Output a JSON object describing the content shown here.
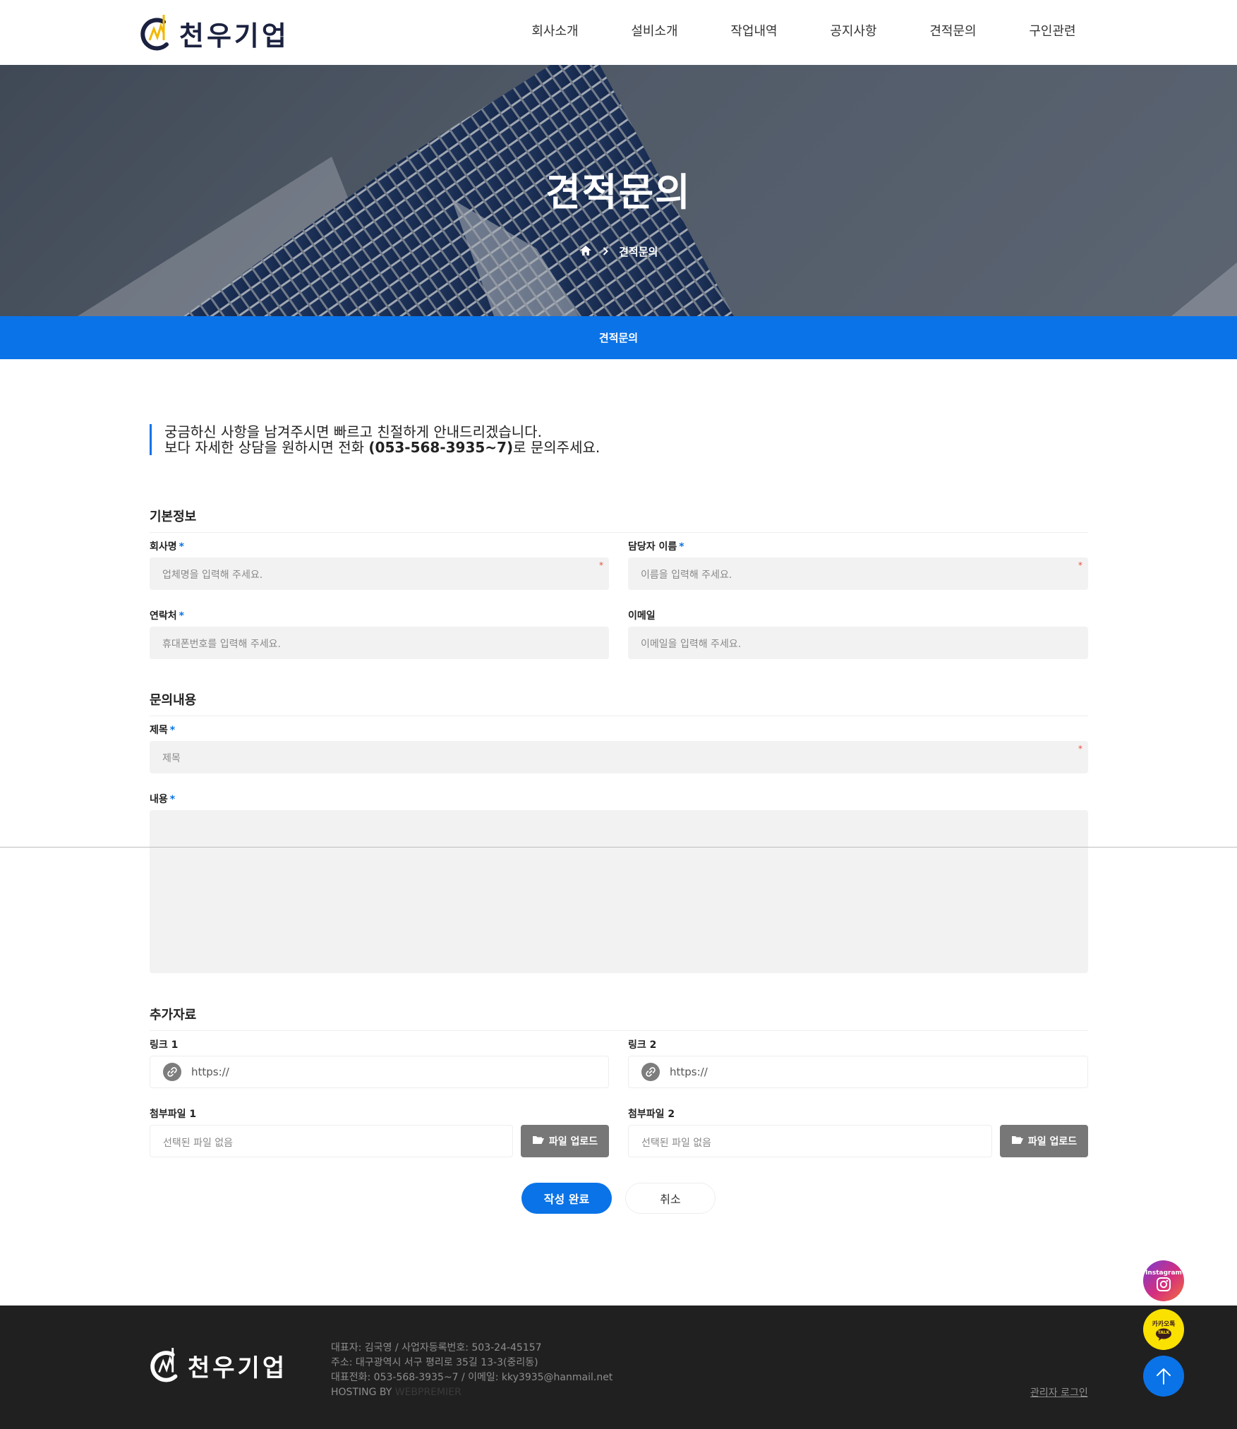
{
  "brand": {
    "name": "천우기업"
  },
  "nav": [
    {
      "label": "회사소개"
    },
    {
      "label": "설비소개"
    },
    {
      "label": "작업내역"
    },
    {
      "label": "공지사항"
    },
    {
      "label": "견적문의"
    },
    {
      "label": "구인관련"
    }
  ],
  "hero": {
    "title": "견적문의",
    "breadcrumb_current": "견적문의"
  },
  "tabbar": {
    "label": "견적문의"
  },
  "intro": {
    "line1": "궁금하신 사항을 남겨주시면 빠르고 친절하게 안내드리겠습니다.",
    "line2_prefix": "보다 자세한 상담을 원하시면 전화 ",
    "line2_phone": "(053-568-3935~7)",
    "line2_suffix": "로 문의주세요."
  },
  "sections": {
    "basic": "기본정보",
    "inquiry": "문의내용",
    "extra": "추가자료"
  },
  "fields": {
    "company": {
      "label": "회사명",
      "placeholder": "업체명을 입력해 주세요."
    },
    "manager": {
      "label": "담당자 이름",
      "placeholder": "이름을 입력해 주세요."
    },
    "contact": {
      "label": "연락처",
      "placeholder": "휴대폰번호를 입력해 주세요."
    },
    "email": {
      "label": "이메일",
      "placeholder": "이메일을 입력해 주세요."
    },
    "subject": {
      "label": "제목",
      "placeholder": "제목"
    },
    "content": {
      "label": "내용"
    },
    "link1": {
      "label": "링크 1",
      "placeholder": "https://"
    },
    "link2": {
      "label": "링크 2",
      "placeholder": "https://"
    },
    "file1": {
      "label": "첨부파일 1",
      "placeholder": "선택된 파일 없음",
      "button": "파일 업로드"
    },
    "file2": {
      "label": "첨부파일 2",
      "placeholder": "선택된 파일 없음",
      "button": "파일 업로드"
    }
  },
  "required_mark": "*",
  "actions": {
    "submit": "작성 완료",
    "cancel": "취소"
  },
  "floating": {
    "instagram": "Instagram",
    "kakao_top": "카카오톡",
    "kakao_bubble": "TALK"
  },
  "footer": {
    "line1": "대표자: 김국영 / 사업자등록번호: 503-24-45157",
    "line2": "주소: 대구광역시 서구 평리로 35길 13-3(중리동)",
    "line3": "대표전화: 053-568-3935~7 / 이메일: kky3935@hanmail.net",
    "hosting_label": "HOSTING BY ",
    "hosting_name": "WEBPREMIER",
    "admin_login": "관리자 로그인"
  },
  "colors": {
    "accent": "#0a73e8",
    "footer_bg": "#202020",
    "field_bg": "#f2f2f2",
    "logo_yellow": "#f2b800",
    "logo_navy": "#1b2240"
  }
}
